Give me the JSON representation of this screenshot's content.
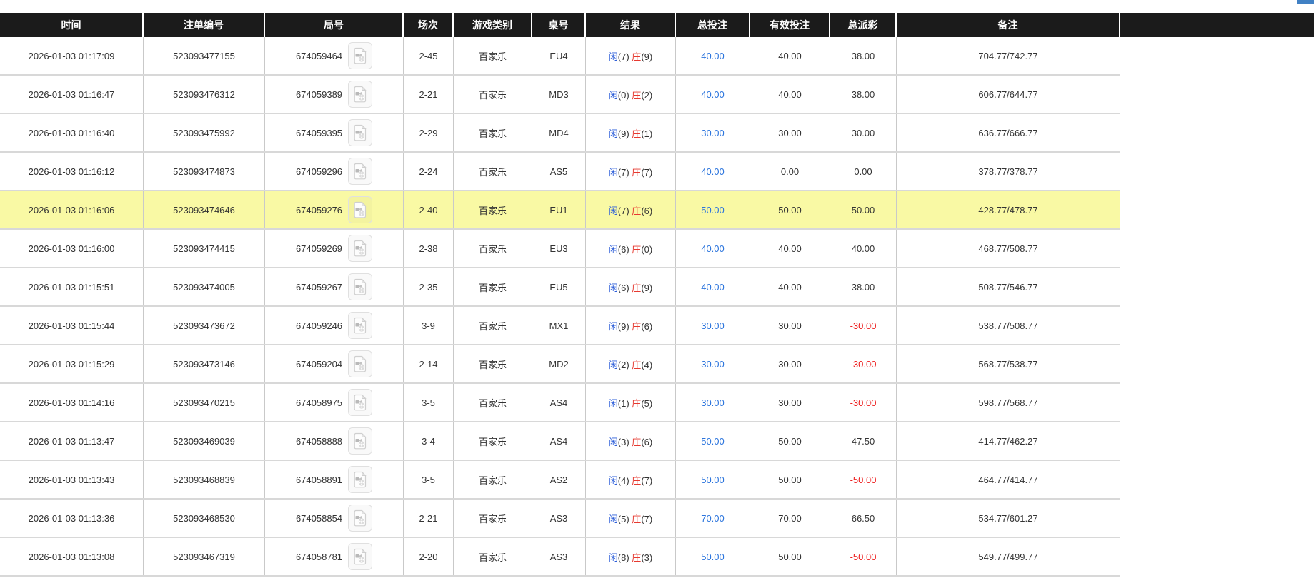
{
  "colors": {
    "accent": "#4181c4",
    "header_bg": "#1b1b1b",
    "highlight": "#f9f9a4",
    "player": "#2e5fd9",
    "banker": "#e63a31",
    "bet_link": "#2b74dd",
    "negative": "#ed1c1c"
  },
  "table": {
    "columns": [
      {
        "key": "time",
        "label": "时间"
      },
      {
        "key": "bet_id",
        "label": "注单编号"
      },
      {
        "key": "round_id",
        "label": "局号"
      },
      {
        "key": "session",
        "label": "场次"
      },
      {
        "key": "game_type",
        "label": "游戏类别"
      },
      {
        "key": "table_no",
        "label": "桌号"
      },
      {
        "key": "result",
        "label": "结果"
      },
      {
        "key": "total_bet",
        "label": "总投注"
      },
      {
        "key": "valid_bet",
        "label": "有效投注"
      },
      {
        "key": "total_payout",
        "label": "总派彩"
      },
      {
        "key": "remark",
        "label": "备注"
      }
    ],
    "result_labels": {
      "player": "闲",
      "banker": "庄"
    },
    "rows": [
      {
        "time": "2026-01-03 01:17:09",
        "bet_id": "523093477155",
        "round_id": "674059464",
        "session": "2-45",
        "game_type": "百家乐",
        "table_no": "EU4",
        "player_score": "7",
        "banker_score": "9",
        "total_bet": "40.00",
        "valid_bet": "40.00",
        "total_payout": "38.00",
        "remark": "704.77/742.77",
        "highlighted": false
      },
      {
        "time": "2026-01-03 01:16:47",
        "bet_id": "523093476312",
        "round_id": "674059389",
        "session": "2-21",
        "game_type": "百家乐",
        "table_no": "MD3",
        "player_score": "0",
        "banker_score": "2",
        "total_bet": "40.00",
        "valid_bet": "40.00",
        "total_payout": "38.00",
        "remark": "606.77/644.77",
        "highlighted": false
      },
      {
        "time": "2026-01-03 01:16:40",
        "bet_id": "523093475992",
        "round_id": "674059395",
        "session": "2-29",
        "game_type": "百家乐",
        "table_no": "MD4",
        "player_score": "9",
        "banker_score": "1",
        "total_bet": "30.00",
        "valid_bet": "30.00",
        "total_payout": "30.00",
        "remark": "636.77/666.77",
        "highlighted": false
      },
      {
        "time": "2026-01-03 01:16:12",
        "bet_id": "523093474873",
        "round_id": "674059296",
        "session": "2-24",
        "game_type": "百家乐",
        "table_no": "AS5",
        "player_score": "7",
        "banker_score": "7",
        "total_bet": "40.00",
        "valid_bet": "0.00",
        "total_payout": "0.00",
        "remark": "378.77/378.77",
        "highlighted": false
      },
      {
        "time": "2026-01-03 01:16:06",
        "bet_id": "523093474646",
        "round_id": "674059276",
        "session": "2-40",
        "game_type": "百家乐",
        "table_no": "EU1",
        "player_score": "7",
        "banker_score": "6",
        "total_bet": "50.00",
        "valid_bet": "50.00",
        "total_payout": "50.00",
        "remark": "428.77/478.77",
        "highlighted": true
      },
      {
        "time": "2026-01-03 01:16:00",
        "bet_id": "523093474415",
        "round_id": "674059269",
        "session": "2-38",
        "game_type": "百家乐",
        "table_no": "EU3",
        "player_score": "6",
        "banker_score": "0",
        "total_bet": "40.00",
        "valid_bet": "40.00",
        "total_payout": "40.00",
        "remark": "468.77/508.77",
        "highlighted": false
      },
      {
        "time": "2026-01-03 01:15:51",
        "bet_id": "523093474005",
        "round_id": "674059267",
        "session": "2-35",
        "game_type": "百家乐",
        "table_no": "EU5",
        "player_score": "6",
        "banker_score": "9",
        "total_bet": "40.00",
        "valid_bet": "40.00",
        "total_payout": "38.00",
        "remark": "508.77/546.77",
        "highlighted": false
      },
      {
        "time": "2026-01-03 01:15:44",
        "bet_id": "523093473672",
        "round_id": "674059246",
        "session": "3-9",
        "game_type": "百家乐",
        "table_no": "MX1",
        "player_score": "9",
        "banker_score": "6",
        "total_bet": "30.00",
        "valid_bet": "30.00",
        "total_payout": "-30.00",
        "remark": "538.77/508.77",
        "highlighted": false
      },
      {
        "time": "2026-01-03 01:15:29",
        "bet_id": "523093473146",
        "round_id": "674059204",
        "session": "2-14",
        "game_type": "百家乐",
        "table_no": "MD2",
        "player_score": "2",
        "banker_score": "4",
        "total_bet": "30.00",
        "valid_bet": "30.00",
        "total_payout": "-30.00",
        "remark": "568.77/538.77",
        "highlighted": false
      },
      {
        "time": "2026-01-03 01:14:16",
        "bet_id": "523093470215",
        "round_id": "674058975",
        "session": "3-5",
        "game_type": "百家乐",
        "table_no": "AS4",
        "player_score": "1",
        "banker_score": "5",
        "total_bet": "30.00",
        "valid_bet": "30.00",
        "total_payout": "-30.00",
        "remark": "598.77/568.77",
        "highlighted": false
      },
      {
        "time": "2026-01-03 01:13:47",
        "bet_id": "523093469039",
        "round_id": "674058888",
        "session": "3-4",
        "game_type": "百家乐",
        "table_no": "AS4",
        "player_score": "3",
        "banker_score": "6",
        "total_bet": "50.00",
        "valid_bet": "50.00",
        "total_payout": "47.50",
        "remark": "414.77/462.27",
        "highlighted": false
      },
      {
        "time": "2026-01-03 01:13:43",
        "bet_id": "523093468839",
        "round_id": "674058891",
        "session": "3-5",
        "game_type": "百家乐",
        "table_no": "AS2",
        "player_score": "4",
        "banker_score": "7",
        "total_bet": "50.00",
        "valid_bet": "50.00",
        "total_payout": "-50.00",
        "remark": "464.77/414.77",
        "highlighted": false
      },
      {
        "time": "2026-01-03 01:13:36",
        "bet_id": "523093468530",
        "round_id": "674058854",
        "session": "2-21",
        "game_type": "百家乐",
        "table_no": "AS3",
        "player_score": "5",
        "banker_score": "7",
        "total_bet": "70.00",
        "valid_bet": "70.00",
        "total_payout": "66.50",
        "remark": "534.77/601.27",
        "highlighted": false
      },
      {
        "time": "2026-01-03 01:13:08",
        "bet_id": "523093467319",
        "round_id": "674058781",
        "session": "2-20",
        "game_type": "百家乐",
        "table_no": "AS3",
        "player_score": "8",
        "banker_score": "3",
        "total_bet": "50.00",
        "valid_bet": "50.00",
        "total_payout": "-50.00",
        "remark": "549.77/499.77",
        "highlighted": false
      }
    ]
  }
}
